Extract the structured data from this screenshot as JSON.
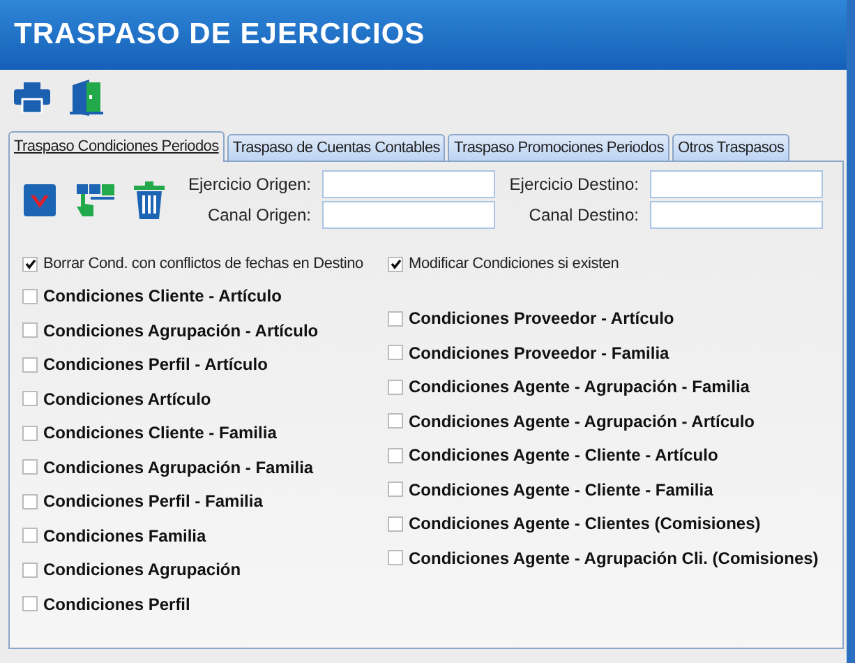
{
  "window": {
    "title": "TRASPASO DE EJERCICIOS"
  },
  "tabs": [
    {
      "label": "Traspaso Condiciones Periodos",
      "selected": true
    },
    {
      "label": "Traspaso de Cuentas Contables",
      "selected": false
    },
    {
      "label": "Traspaso Promociones Periodos",
      "selected": false
    },
    {
      "label": "Otros Traspasos",
      "selected": false
    }
  ],
  "fields_left": [
    {
      "label": "Ejercicio Origen:"
    },
    {
      "label": "Canal Origen:"
    }
  ],
  "fields_right": [
    {
      "label": "Ejercicio Destino:"
    },
    {
      "label": "Canal Destino:"
    }
  ],
  "options": [
    {
      "label": "Borrar Cond. con conflictos de fechas en Destino",
      "checked": true
    },
    {
      "label": "Modificar Condiciones si existen",
      "checked": true
    }
  ],
  "conditions_left": [
    {
      "label": "Condiciones Cliente - Artículo",
      "checked": false
    },
    {
      "label": "Condiciones Agrupación - Artículo",
      "checked": false
    },
    {
      "label": "Condiciones Perfil - Artículo",
      "checked": false
    },
    {
      "label": "Condiciones Artículo",
      "checked": false
    },
    {
      "label": "Condiciones Cliente - Familia",
      "checked": false
    },
    {
      "label": "Condiciones Agrupación - Familia",
      "checked": false
    },
    {
      "label": "Condiciones Perfil - Familia",
      "checked": false
    },
    {
      "label": "Condiciones Familia",
      "checked": false
    },
    {
      "label": "Condiciones Agrupación",
      "checked": false
    },
    {
      "label": "Condiciones Perfil",
      "checked": false
    }
  ],
  "conditions_right": [
    {
      "label": "Condiciones Proveedor - Artículo",
      "checked": false
    },
    {
      "label": "Condiciones Proveedor - Familia",
      "checked": false
    },
    {
      "label": "Condiciones Agente - Agrupación - Familia",
      "checked": false
    },
    {
      "label": "Condiciones Agente - Agrupación - Artículo",
      "checked": false
    },
    {
      "label": "Condiciones Agente - Cliente - Artículo",
      "checked": false
    },
    {
      "label": "Condiciones Agente - Cliente - Familia",
      "checked": false
    },
    {
      "label": "Condiciones Agente - Clientes (Comisiones)",
      "checked": false
    },
    {
      "label": "Condiciones Agente - Agrupación Cli. (Comisiones)",
      "checked": false
    }
  ]
}
